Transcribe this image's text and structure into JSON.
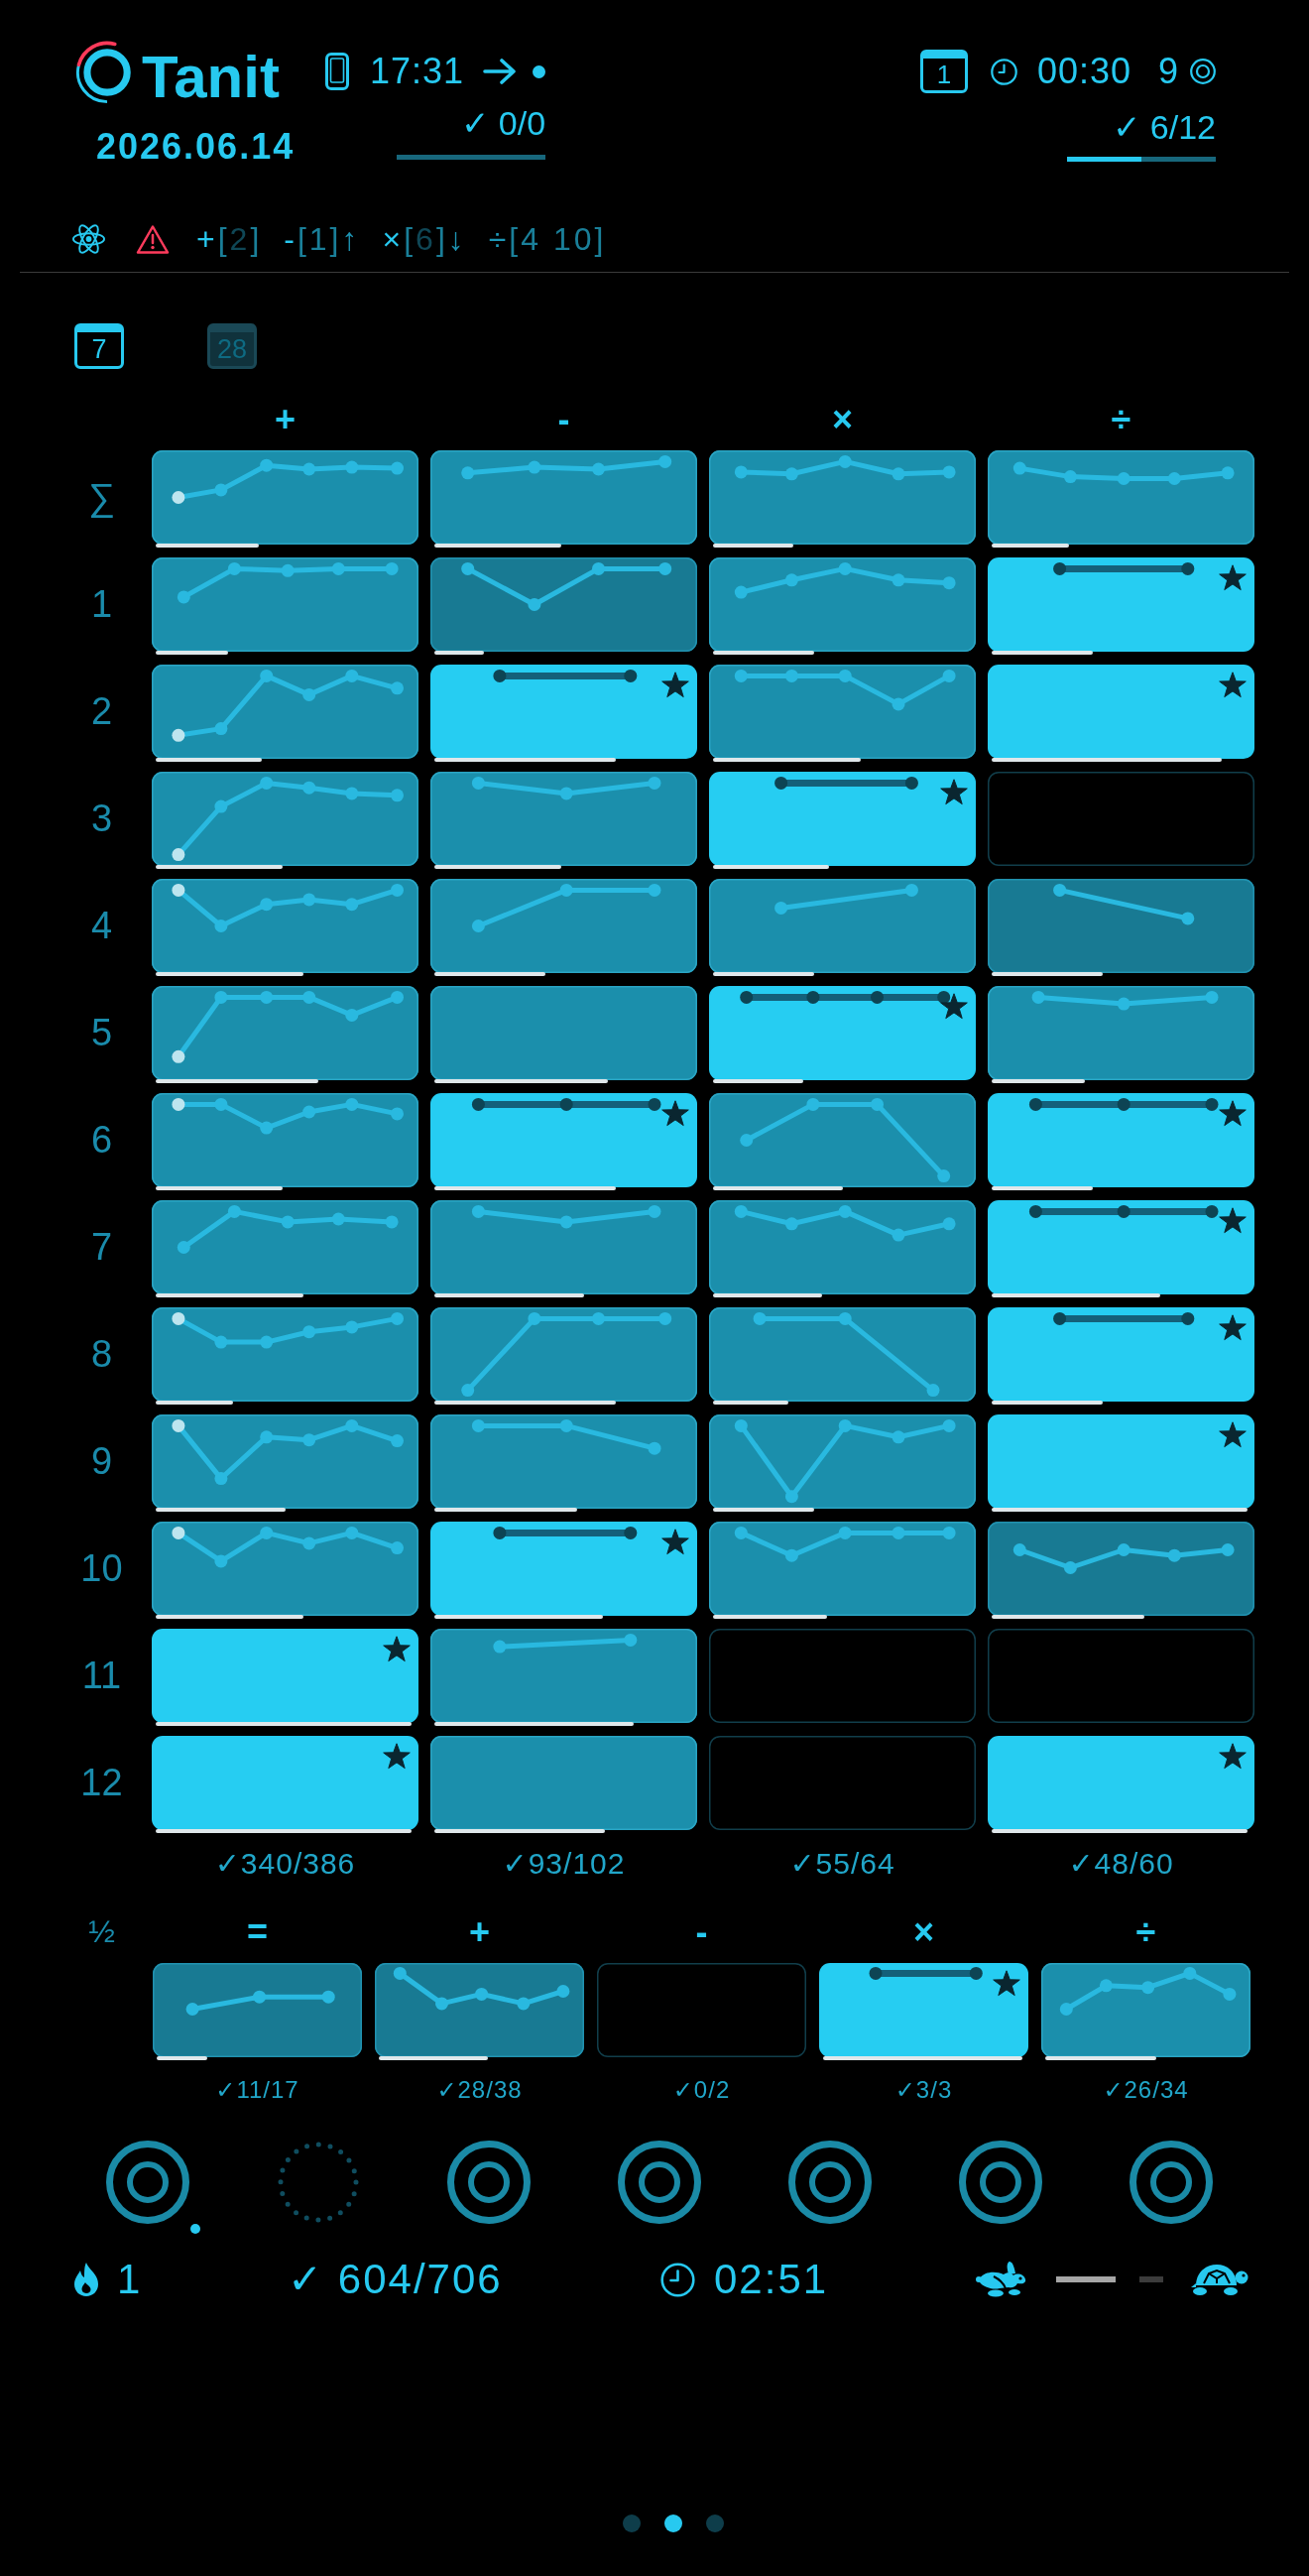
{
  "header": {
    "title": "Tanit",
    "date": "2026.06.14",
    "session": {
      "time": "17:31",
      "score": "✓ 0/0",
      "level": 0
    },
    "goal": {
      "day": "1",
      "timer": "00:30",
      "targets": "9",
      "score": "✓ 6/12",
      "level": 0.5
    }
  },
  "filters": [
    {
      "op": "+",
      "on": true,
      "open": "[",
      "value": "2",
      "active": false,
      "close": "]"
    },
    {
      "op": "-",
      "on": true,
      "open": "[",
      "value": "1",
      "active": true,
      "close": "]",
      "trend": "↑"
    },
    {
      "op": "×",
      "on": true,
      "open": "[",
      "value": "6",
      "active": false,
      "close": "]",
      "trend": "↓"
    },
    {
      "op": "÷",
      "on": false,
      "open": "[",
      "value": "4 10",
      "active": true,
      "close": "]"
    }
  ],
  "tabs": [
    {
      "label": "7",
      "selected": true
    },
    {
      "label": "28",
      "selected": false
    }
  ],
  "grid": {
    "columns": [
      "+",
      "-",
      "×",
      "÷"
    ],
    "rows": [
      {
        "label": "∑",
        "tiles": [
          {
            "kind": "trend",
            "dim": false,
            "level": 0.4
          },
          {
            "kind": "trend",
            "dim": false,
            "level": 0.49
          },
          {
            "kind": "trend",
            "dim": false,
            "level": 0.31
          },
          {
            "kind": "trend",
            "dim": false,
            "level": 0.3
          }
        ]
      },
      {
        "label": "1",
        "tiles": [
          {
            "kind": "trend",
            "dim": false,
            "level": 0.28
          },
          {
            "kind": "trend",
            "dim": true,
            "level": 0.19
          },
          {
            "kind": "trend",
            "dim": false,
            "level": 0.39
          },
          {
            "kind": "mastered",
            "dim": false,
            "level": 0.39
          }
        ]
      },
      {
        "label": "2",
        "tiles": [
          {
            "kind": "trend",
            "dim": false,
            "level": 0.41
          },
          {
            "kind": "mastered",
            "dim": false,
            "level": 0.7
          },
          {
            "kind": "trend",
            "dim": false,
            "level": 0.57
          },
          {
            "kind": "mastered",
            "dim": false,
            "level": 0.89
          }
        ]
      },
      {
        "label": "3",
        "tiles": [
          {
            "kind": "trend",
            "dim": false,
            "level": 0.49
          },
          {
            "kind": "trend",
            "dim": false,
            "level": 0.49
          },
          {
            "kind": "mastered",
            "dim": false,
            "level": 0.45
          },
          {
            "kind": "empty",
            "dim": false
          }
        ]
      },
      {
        "label": "4",
        "tiles": [
          {
            "kind": "trend",
            "dim": false,
            "level": 0.57
          },
          {
            "kind": "trend",
            "dim": false,
            "level": 0.43
          },
          {
            "kind": "trend",
            "dim": false,
            "level": 0.39
          },
          {
            "kind": "trend",
            "dim": true,
            "level": 0.43
          }
        ]
      },
      {
        "label": "5",
        "tiles": [
          {
            "kind": "trend",
            "dim": false,
            "level": 0.63
          },
          {
            "kind": "trend",
            "dim": false,
            "level": 0.67
          },
          {
            "kind": "mastered",
            "dim": false,
            "level": 0.35
          },
          {
            "kind": "trend",
            "dim": false,
            "level": 0.36
          }
        ]
      },
      {
        "label": "6",
        "tiles": [
          {
            "kind": "trend",
            "dim": false,
            "level": 0.49
          },
          {
            "kind": "mastered",
            "dim": false,
            "level": 0.7
          },
          {
            "kind": "trend",
            "dim": false,
            "level": 0.5
          },
          {
            "kind": "mastered",
            "dim": false,
            "level": 0.39
          }
        ]
      },
      {
        "label": "7",
        "tiles": [
          {
            "kind": "trend",
            "dim": false,
            "level": 0.57
          },
          {
            "kind": "trend",
            "dim": false,
            "level": 0.58
          },
          {
            "kind": "trend",
            "dim": false,
            "level": 0.42
          },
          {
            "kind": "mastered",
            "dim": false,
            "level": 0.65
          }
        ]
      },
      {
        "label": "8",
        "tiles": [
          {
            "kind": "trend",
            "dim": false,
            "level": 0.3
          },
          {
            "kind": "trend",
            "dim": false,
            "level": 0.7
          },
          {
            "kind": "trend",
            "dim": false,
            "level": 0.29
          },
          {
            "kind": "mastered",
            "dim": false,
            "level": 0.43
          }
        ]
      },
      {
        "label": "9",
        "tiles": [
          {
            "kind": "trend",
            "dim": false,
            "level": 0.5
          },
          {
            "kind": "trend",
            "dim": false,
            "level": 0.55
          },
          {
            "kind": "trend",
            "dim": false,
            "level": 0.39
          },
          {
            "kind": "mastered",
            "dim": false,
            "level": 0.99
          }
        ]
      },
      {
        "label": "10",
        "tiles": [
          {
            "kind": "trend",
            "dim": false,
            "level": 0.57
          },
          {
            "kind": "mastered",
            "dim": false,
            "level": 0.65
          },
          {
            "kind": "trend",
            "dim": false,
            "level": 0.44
          },
          {
            "kind": "trend",
            "dim": true,
            "level": 0.59
          }
        ]
      },
      {
        "label": "11",
        "tiles": [
          {
            "kind": "mastered",
            "dim": false,
            "level": 0.99
          },
          {
            "kind": "trend",
            "dim": false,
            "level": 0.77
          },
          {
            "kind": "empty",
            "dim": false
          },
          {
            "kind": "empty",
            "dim": false
          }
        ]
      },
      {
        "label": "12",
        "tiles": [
          {
            "kind": "mastered",
            "dim": false,
            "level": 0.99
          },
          {
            "kind": "trend",
            "dim": false,
            "level": 0.66
          },
          {
            "kind": "empty",
            "dim": false
          },
          {
            "kind": "mastered",
            "dim": false,
            "level": 0.99
          }
        ]
      }
    ],
    "totals": [
      "✓340/386",
      "✓93/102",
      "✓55/64",
      "✓48/60"
    ]
  },
  "half": {
    "label": "½",
    "columns": [
      "=",
      "+",
      "-",
      "×",
      "÷"
    ],
    "tiles": [
      {
        "kind": "trend",
        "dim": true,
        "level": 0.25
      },
      {
        "kind": "trend",
        "dim": true,
        "level": 0.54
      },
      {
        "kind": "empty",
        "dim": false
      },
      {
        "kind": "mastered",
        "dim": false,
        "level": 0.99
      },
      {
        "kind": "trend",
        "dim": false,
        "level": 0.55
      }
    ],
    "totals": [
      "✓11/17",
      "✓28/38",
      "✓0/2",
      "✓3/3",
      "✓26/34"
    ]
  },
  "rings": [
    {
      "kind": "ring",
      "current": true
    },
    {
      "kind": "dotted",
      "current": false
    },
    {
      "kind": "ring",
      "current": false
    },
    {
      "kind": "ring",
      "current": false
    },
    {
      "kind": "ring",
      "current": false
    },
    {
      "kind": "ring",
      "current": false
    },
    {
      "kind": "ring",
      "current": false
    }
  ],
  "stats": {
    "streak": "1",
    "score": "✓ 604/706",
    "time": "02:51",
    "speed": {
      "level": 0.56
    }
  },
  "pages": [
    {
      "selected": false
    },
    {
      "selected": true
    },
    {
      "selected": false
    }
  ]
}
